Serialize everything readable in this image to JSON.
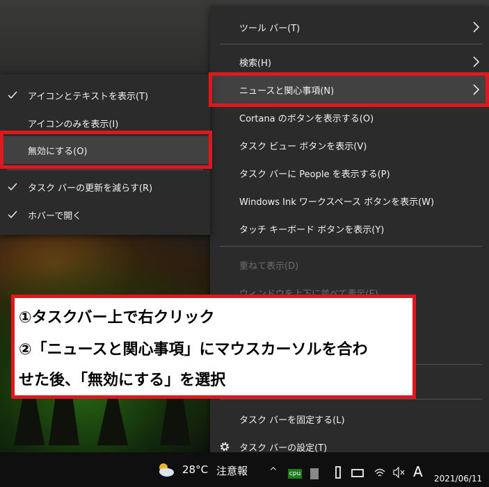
{
  "context_menu": {
    "items": [
      {
        "label": "ツール バー(T)",
        "has_submenu": true,
        "enabled": true
      },
      {
        "label": "検索(H)",
        "has_submenu": true,
        "enabled": true
      },
      {
        "label": "ニュースと関心事項(N)",
        "has_submenu": true,
        "enabled": true,
        "highlighted": true
      },
      {
        "label": "Cortana のボタンを表示する(O)",
        "enabled": true
      },
      {
        "label": "タスク ビュー ボタンを表示(V)",
        "enabled": true
      },
      {
        "label": "タスク バーに People を表示する(P)",
        "enabled": true
      },
      {
        "label": "Windows Ink ワークスペース ボタンを表示(W)",
        "enabled": true
      },
      {
        "label": "タッチ キーボード ボタンを表示(Y)",
        "enabled": true
      },
      {
        "label": "重ねて表示(D)",
        "enabled": false
      },
      {
        "label": "ウィンドウを上下に並べて表示(E)",
        "enabled": false
      },
      {
        "label": "タスク バーを固定する(L)",
        "enabled": true
      },
      {
        "label": "タスク バーの設定(T)",
        "enabled": true,
        "icon": "gear-icon"
      }
    ]
  },
  "submenu": {
    "items": [
      {
        "label": "アイコンとテキストを表示(T)",
        "checked": true
      },
      {
        "label": "アイコンのみを表示(I)",
        "checked": false
      },
      {
        "label": "無効にする(O)",
        "checked": false,
        "highlighted": true
      },
      {
        "label": "タスク バーの更新を減らす(R)",
        "checked": true
      },
      {
        "label": "ホバーで開く",
        "checked": true
      }
    ]
  },
  "callout": {
    "line1": "①タスクバー上で右クリック",
    "line2": "②「ニュースと関心事項」にマウスカーソルを合わ",
    "line3": "せた後、「無効にする」を選択"
  },
  "taskbar": {
    "weather_temp": "28°C",
    "weather_text": "注意報",
    "weather_icon": "partly-cloudy-icon",
    "cpu_label": "cpu",
    "ime_label": "A",
    "date": "2021/06/11"
  },
  "colors": {
    "menu_bg": "#2b2b2b",
    "menu_hover": "#414141",
    "highlight_border": "#e0181e",
    "text": "#f2f2f2",
    "disabled_text": "#6d6d6d"
  }
}
